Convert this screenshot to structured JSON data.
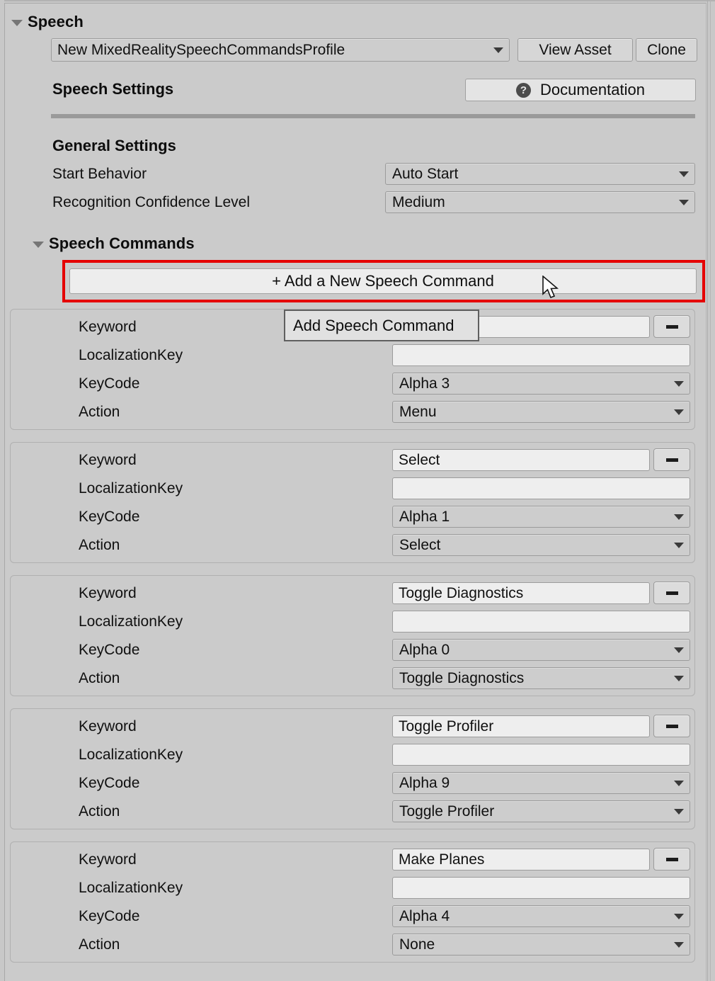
{
  "panel": {
    "section_title": "Speech",
    "profile": {
      "value": "New MixedRealitySpeechCommandsProfile",
      "view_asset_label": "View Asset",
      "clone_label": "Clone"
    },
    "speech_settings_title": "Speech Settings",
    "documentation_label": "Documentation",
    "documentation_icon": "help-circle-icon",
    "general_settings_title": "General Settings",
    "general_settings": [
      {
        "label": "Start Behavior",
        "value": "Auto Start"
      },
      {
        "label": "Recognition Confidence Level",
        "value": "Medium"
      }
    ],
    "speech_commands_title": "Speech Commands",
    "add_command_label": "+ Add a New Speech Command",
    "remove_label": "-",
    "field_labels": {
      "keyword": "Keyword",
      "localization_key": "LocalizationKey",
      "keycode": "KeyCode",
      "action": "Action"
    },
    "commands": [
      {
        "keyword": "",
        "localization_key": "",
        "keycode": "Alpha 3",
        "action": "Menu"
      },
      {
        "keyword": "Select",
        "localization_key": "",
        "keycode": "Alpha 1",
        "action": "Select"
      },
      {
        "keyword": "Toggle Diagnostics",
        "localization_key": "",
        "keycode": "Alpha 0",
        "action": "Toggle Diagnostics"
      },
      {
        "keyword": "Toggle Profiler",
        "localization_key": "",
        "keycode": "Alpha 9",
        "action": "Toggle Profiler"
      },
      {
        "keyword": "Make Planes",
        "localization_key": "",
        "keycode": "Alpha 4",
        "action": "None"
      }
    ],
    "tooltip": "Add Speech Command",
    "highlight_color": "#e50000",
    "cursor_icon": "arrow-pointer-cursor"
  }
}
